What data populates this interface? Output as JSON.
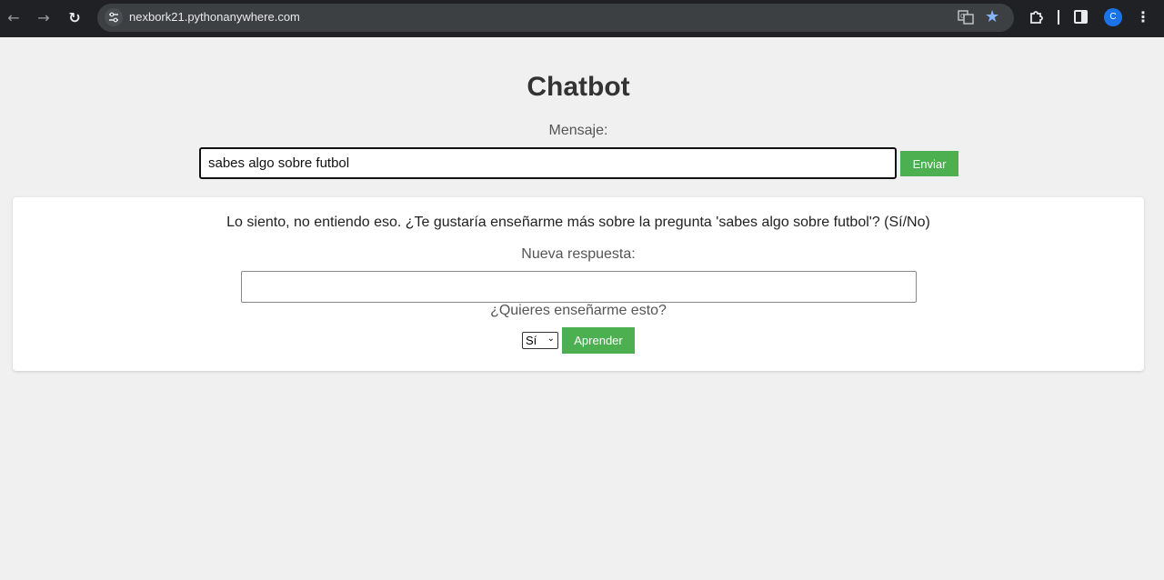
{
  "browser": {
    "url": "nexbork21.pythonanywhere.com",
    "icons": [
      "back-arrow",
      "forward-arrow",
      "reload",
      "site-info",
      "translate",
      "star",
      "extensions",
      "side-panel",
      "profile",
      "menu"
    ],
    "avatar_letter": "C",
    "accent": "#8ab4f8"
  },
  "page": {
    "title": "Chatbot",
    "message_label": "Mensaje:",
    "message_value": "sabes algo sobre futbol",
    "send_label": "Enviar"
  },
  "response": {
    "bot_text": "Lo siento, no entiendo eso. ¿Te gustaría enseñarme más sobre la pregunta 'sabes algo sobre futbol'? (Sí/No)",
    "new_answer_label": "Nueva respuesta:",
    "new_answer_value": "",
    "teach_question": "¿Quieres enseñarme esto?",
    "teach_selected": "Sí",
    "learn_label": "Aprender"
  },
  "colors": {
    "button_green": "#4caf50",
    "page_bg": "#f0f0f0"
  }
}
